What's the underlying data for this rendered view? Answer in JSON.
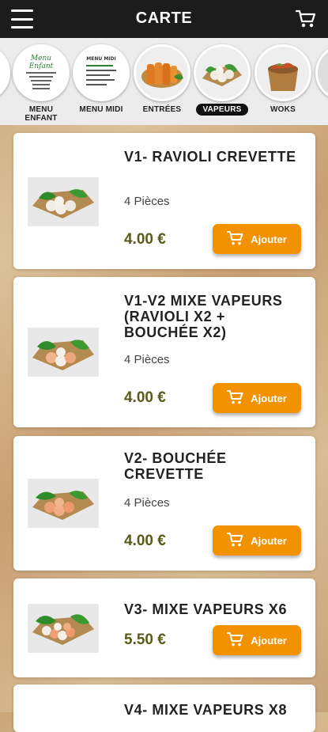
{
  "header": {
    "title": "CARTE"
  },
  "categories": [
    {
      "label": "",
      "style": "partial-left"
    },
    {
      "label": "MENU\nENFANT",
      "title": "Menu Enfant"
    },
    {
      "label": "MENU MIDI",
      "title": "MENU MIDI"
    },
    {
      "label": "ENTRÉES"
    },
    {
      "label": "VAPEURS",
      "active": true
    },
    {
      "label": "WOKS"
    }
  ],
  "products": [
    {
      "name": "V1- RAVIOLI CREVETTE",
      "desc": "4 Pièces",
      "price": "4.00 €",
      "button": "Ajouter"
    },
    {
      "name": "V1-V2 MIXE VAPEURS (RAVIOLI X2 + BOUCHÉE X2)",
      "desc": "4 Pièces",
      "price": "4.00 €",
      "button": "Ajouter"
    },
    {
      "name": "V2- BOUCHÉE CREVETTE",
      "desc": "4 Pièces",
      "price": "4.00 €",
      "button": "Ajouter"
    },
    {
      "name": "V3- MIXE VAPEURS X6",
      "desc": "",
      "price": "5.50 €",
      "button": "Ajouter"
    },
    {
      "name": "V4- MIXE VAPEURS X8",
      "desc": "",
      "price": "",
      "button": ""
    }
  ],
  "colors": {
    "accent": "#f39200",
    "header_bg": "#1c1c1c",
    "price": "#5a5a1a"
  }
}
